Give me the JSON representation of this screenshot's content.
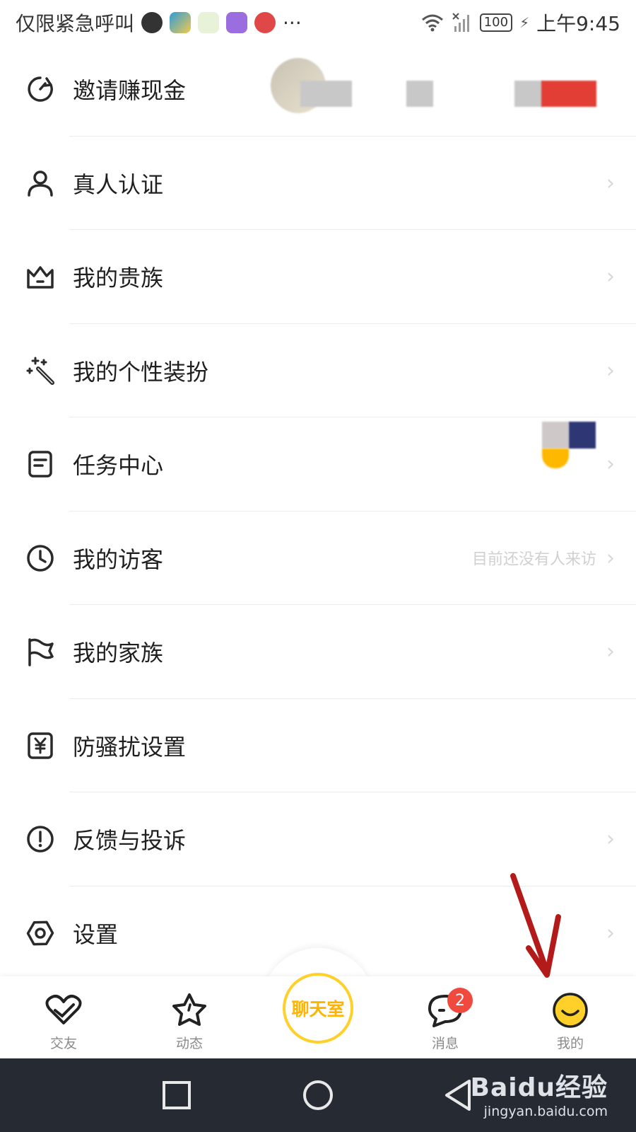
{
  "status_bar": {
    "left_text": "仅限紧急呼叫",
    "more": "···",
    "battery": "100",
    "time": "上午9:45"
  },
  "menu": [
    {
      "label": "邀请赚现金",
      "icon": "refresh-arrow-icon",
      "note": ""
    },
    {
      "label": "真人认证",
      "icon": "person-icon",
      "note": ""
    },
    {
      "label": "我的贵族",
      "icon": "crown-icon",
      "note": ""
    },
    {
      "label": "我的个性装扮",
      "icon": "magic-wand-icon",
      "note": ""
    },
    {
      "label": "任务中心",
      "icon": "task-list-icon",
      "note": ""
    },
    {
      "label": "我的访客",
      "icon": "clock-icon",
      "note": "目前还没有人来访"
    },
    {
      "label": "我的家族",
      "icon": "flag-icon",
      "note": ""
    },
    {
      "label": "防骚扰设置",
      "icon": "yen-box-icon",
      "note": ""
    },
    {
      "label": "反馈与投诉",
      "icon": "exclamation-circle-icon",
      "note": ""
    },
    {
      "label": "设置",
      "icon": "gear-ring-icon",
      "note": ""
    }
  ],
  "chevron": "›",
  "tabs": {
    "friends": "交友",
    "moments": "动态",
    "chatroom": "聊天室",
    "messages": "消息",
    "messages_badge": "2",
    "mine": "我的"
  },
  "watermark": {
    "brand": "Baidu经验",
    "url": "jingyan.baidu.com"
  },
  "colors": {
    "accent_yellow": "#ffd02a",
    "badge_red": "#f04a3e",
    "nav_bg": "#252a33",
    "arrow_red": "#b31b1b"
  }
}
